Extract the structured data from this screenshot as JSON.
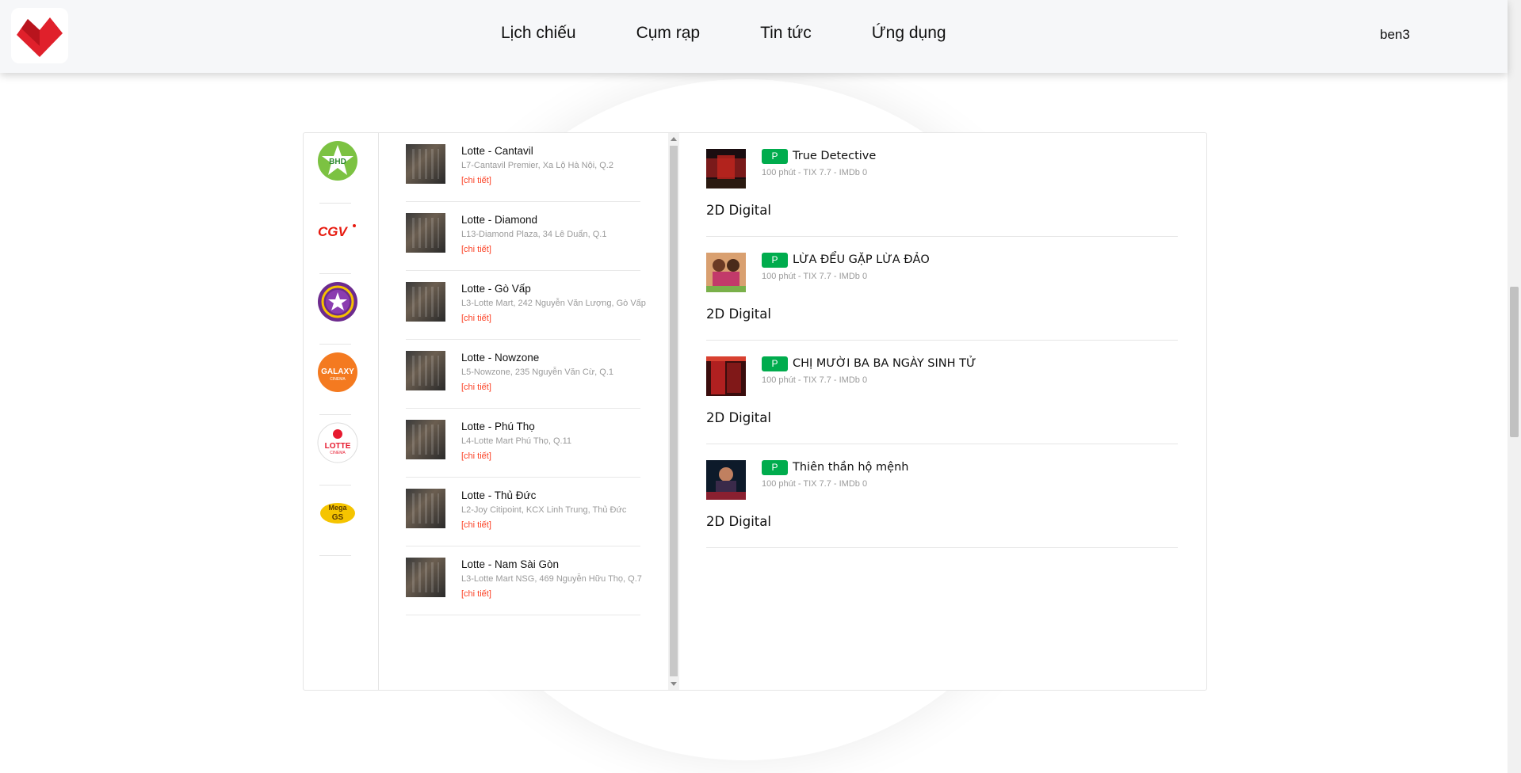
{
  "header": {
    "nav": [
      "Lịch chiếu",
      "Cụm rạp",
      "Tin tức",
      "Ứng dụng"
    ],
    "user": "ben3"
  },
  "brands": [
    {
      "name": "bhd-logo-icon",
      "text": "BHD"
    },
    {
      "name": "cgv-logo-icon",
      "text": "CGV"
    },
    {
      "name": "cinestar-logo-icon",
      "text": "★"
    },
    {
      "name": "galaxy-logo-icon",
      "text": "GALAXY"
    },
    {
      "name": "lotte-logo-icon",
      "text": "LOTTE"
    },
    {
      "name": "megags-logo-icon",
      "text": "Mega GS"
    }
  ],
  "cinemas": [
    {
      "name": "Lotte - Cantavil",
      "address": "L7-Cantavil Premier, Xa Lộ Hà Nội, Q.2",
      "detail": "[chi tiết]"
    },
    {
      "name": "Lotte - Diamond",
      "address": "L13-Diamond Plaza, 34 Lê Duẩn, Q.1",
      "detail": "[chi tiết]"
    },
    {
      "name": "Lotte - Gò Vấp",
      "address": "L3-Lotte Mart, 242 Nguyễn Văn Lượng, Gò Vấp",
      "detail": "[chi tiết]"
    },
    {
      "name": "Lotte - Nowzone",
      "address": "L5-Nowzone, 235 Nguyễn Văn Cừ, Q.1",
      "detail": "[chi tiết]"
    },
    {
      "name": "Lotte - Phú Thọ",
      "address": "L4-Lotte Mart Phú Thọ, Q.11",
      "detail": "[chi tiết]"
    },
    {
      "name": "Lotte - Thủ Đức",
      "address": "L2-Joy Citipoint, KCX Linh Trung, Thủ Đức",
      "detail": "[chi tiết]"
    },
    {
      "name": "Lotte - Nam Sài Gòn",
      "address": "L3-Lotte Mart NSG, 469 Nguyễn Hữu Thọ, Q.7",
      "detail": "[chi tiết]"
    }
  ],
  "movies": [
    {
      "badge": "P",
      "title": "True Detective",
      "meta": "100 phút - TIX 7.7 - IMDb 0",
      "format": "2D Digital"
    },
    {
      "badge": "P",
      "title": "LỪA ĐỂU GẶP LỪA ĐẢO",
      "meta": "100 phút - TIX 7.7 - IMDb 0",
      "format": "2D Digital"
    },
    {
      "badge": "P",
      "title": "CHỊ MƯỜI BA BA NGÀY SINH TỬ",
      "meta": "100 phút - TIX 7.7 - IMDb 0",
      "format": "2D Digital"
    },
    {
      "badge": "P",
      "title": "Thiên thần hộ mệnh",
      "meta": "100 phút - TIX 7.7 - IMDb 0",
      "format": "2D Digital"
    }
  ],
  "colors": {
    "accent": "#fb4226",
    "badge": "#00ac4d",
    "logo": "#e0202b"
  }
}
